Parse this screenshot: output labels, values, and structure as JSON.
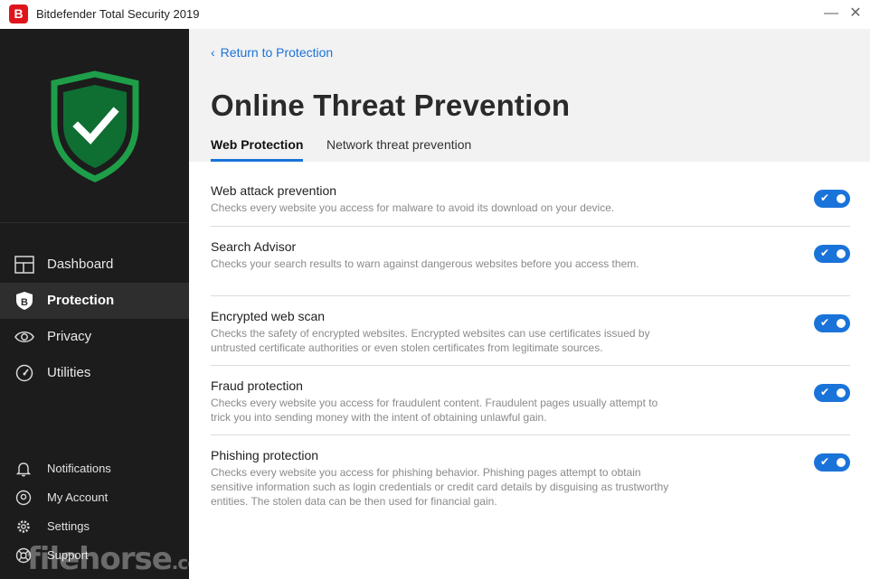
{
  "window": {
    "app_logo_letter": "B",
    "title": "Bitdefender Total Security 2019",
    "minimize_symbol": "—",
    "close_symbol": "✕"
  },
  "sidebar": {
    "shield_icon": "shield-check-icon",
    "shield_color": "#1e9e48",
    "nav": [
      {
        "label": "Dashboard",
        "icon": "dashboard-icon",
        "active": false
      },
      {
        "label": "Protection",
        "icon": "protection-b-icon",
        "active": true
      },
      {
        "label": "Privacy",
        "icon": "eye-icon",
        "active": false
      },
      {
        "label": "Utilities",
        "icon": "gauge-icon",
        "active": false
      }
    ],
    "bottom": [
      {
        "label": "Notifications",
        "icon": "bell-icon"
      },
      {
        "label": "My Account",
        "icon": "user-circle-icon"
      },
      {
        "label": "Settings",
        "icon": "gear-icon"
      },
      {
        "label": "Support",
        "icon": "lifebuoy-icon"
      }
    ]
  },
  "main": {
    "back_label": "Return to Protection",
    "title": "Online Threat Prevention",
    "tabs": [
      {
        "label": "Web Protection",
        "active": true
      },
      {
        "label": "Network threat prevention",
        "active": false
      }
    ],
    "settings": [
      {
        "title": "Web attack prevention",
        "description": "Checks every website you access for malware to avoid its download on your device.",
        "enabled": true
      },
      {
        "title": "Search Advisor",
        "description": "Checks your search results to warn against dangerous websites before you access them.",
        "enabled": true
      },
      {
        "title": "Encrypted web scan",
        "description": "Checks the safety of encrypted websites. Encrypted websites can use certificates issued by untrusted certificate authorities or even stolen certificates from legitimate sources.",
        "enabled": true
      },
      {
        "title": "Fraud protection",
        "description": "Checks every website you access for fraudulent content. Fraudulent pages usually attempt to trick you into sending money with the intent of obtaining unlawful gain.",
        "enabled": true
      },
      {
        "title": "Phishing protection",
        "description": "Checks every website you access for phishing behavior. Phishing pages attempt to obtain sensitive information such as login credentials or credit card details by disguising as trustworthy entities. The stolen data can be then used for financial gain.",
        "enabled": true
      }
    ]
  },
  "colors": {
    "accent": "#1a73d9",
    "sidebar_bg": "#1c1c1c",
    "brand_red": "#e0151c"
  },
  "watermark": {
    "text": "filehorse",
    "suffix": ".com"
  }
}
